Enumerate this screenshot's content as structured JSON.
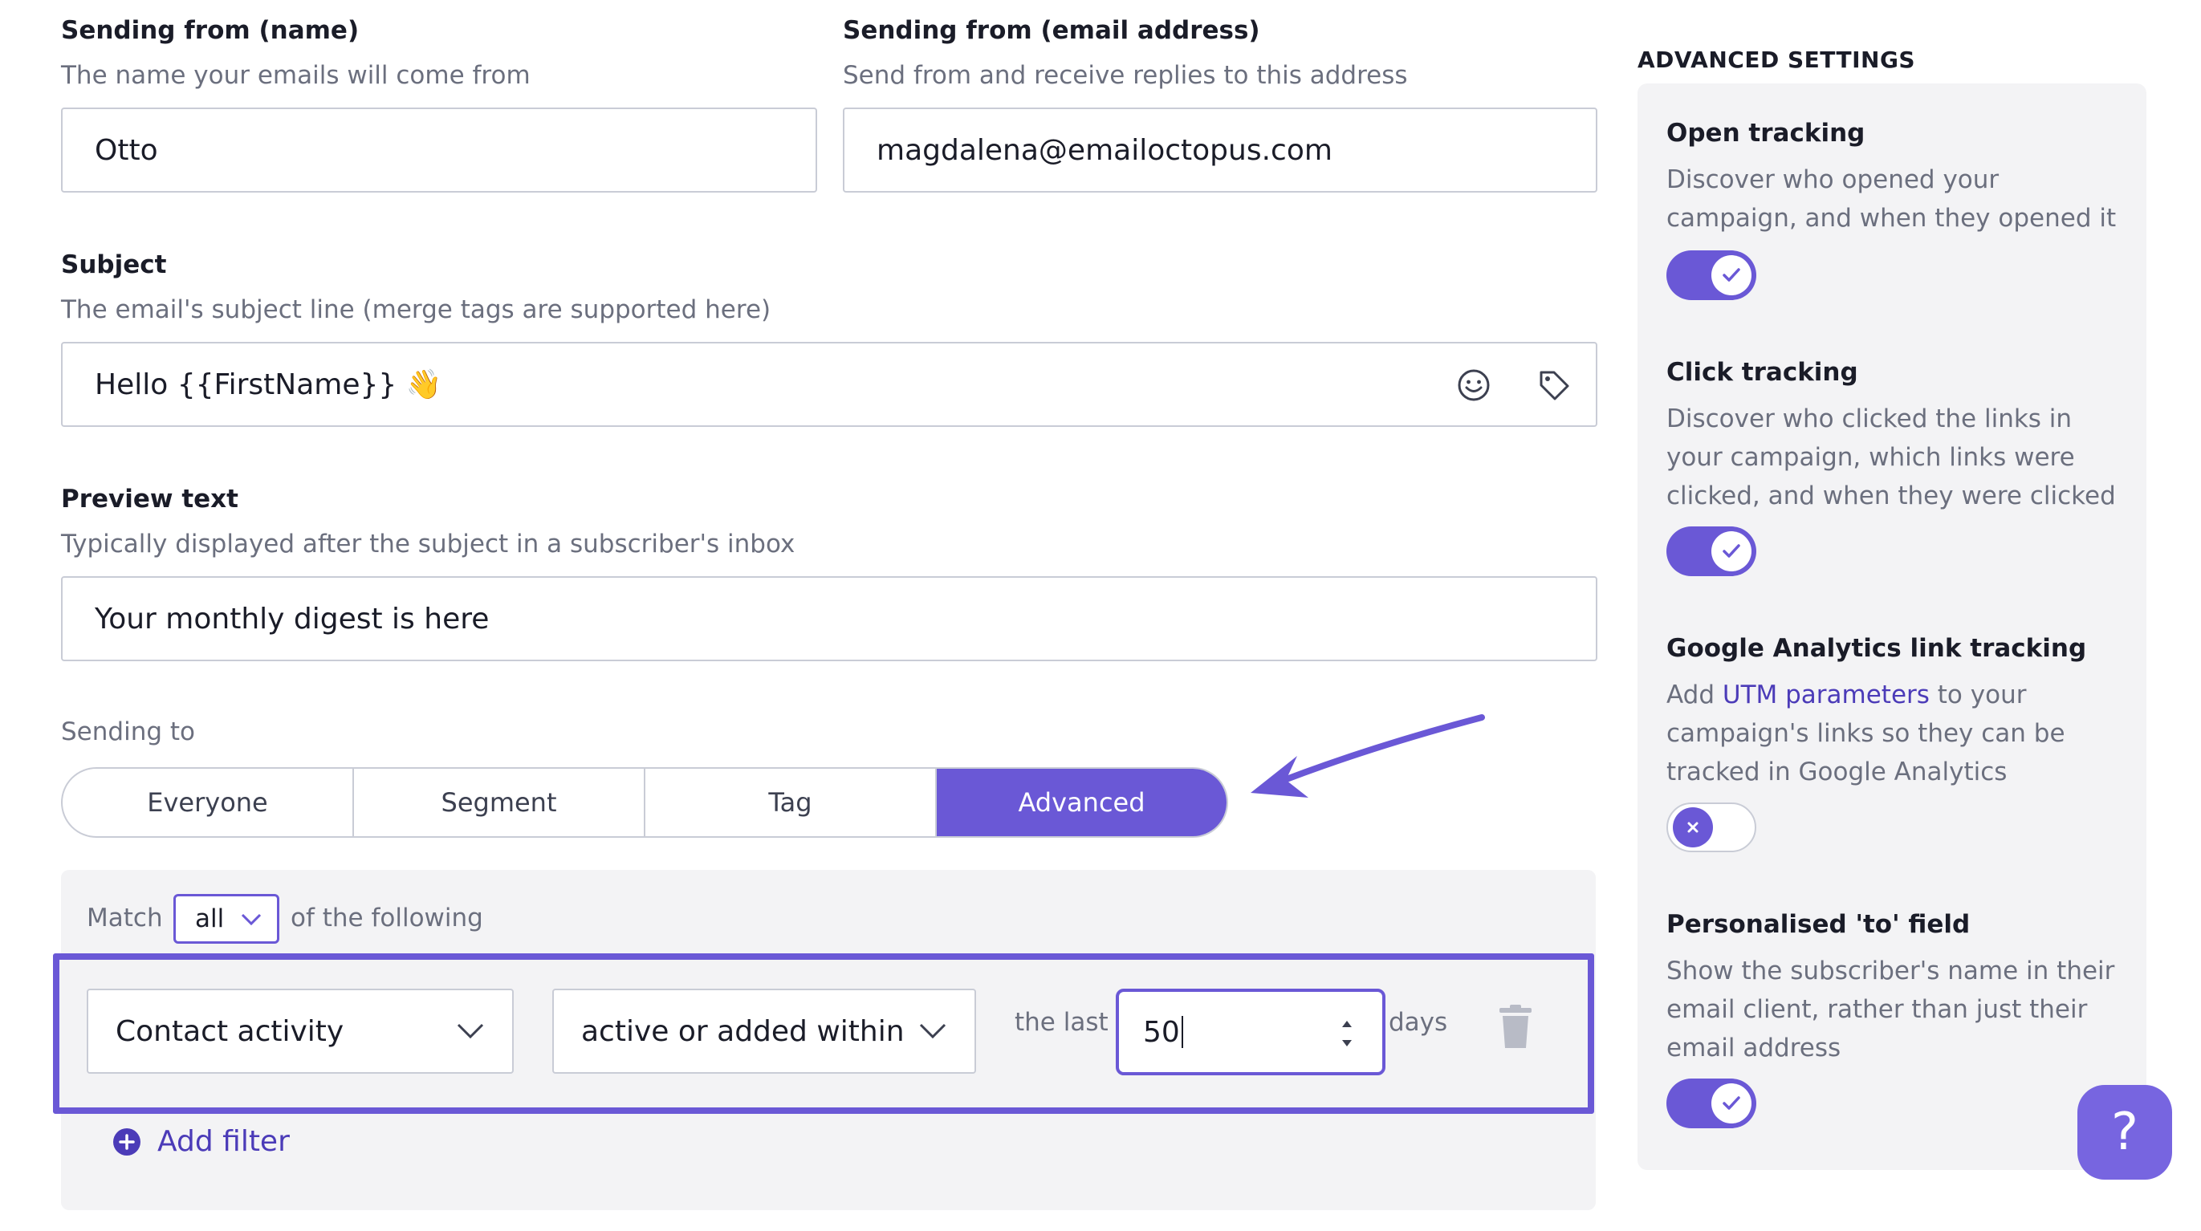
{
  "sender_name": {
    "label": "Sending from (name)",
    "help": "The name your emails will come from",
    "value": "Otto"
  },
  "sender_email": {
    "label": "Sending from (email address)",
    "help": "Send from and receive replies to this address",
    "value": "magdalena@emailoctopus.com"
  },
  "subject": {
    "label": "Subject",
    "help": "The email's subject line (merge tags are supported here)",
    "value": "Hello {{FirstName}} 👋",
    "icons": [
      "emoji-icon",
      "tag-icon"
    ]
  },
  "preview_text": {
    "label": "Preview text",
    "help": "Typically displayed after the subject in a subscriber's inbox",
    "value": "Your monthly digest is here"
  },
  "sending_to": {
    "label": "Sending to",
    "options": [
      "Everyone",
      "Segment",
      "Tag",
      "Advanced"
    ],
    "selected": "Advanced",
    "accent_color": "#6a58d6"
  },
  "advanced": {
    "match_prefix": "Match",
    "match_value": "all",
    "match_suffix": "of the following",
    "rule": {
      "field": "Contact activity",
      "condition": "active or added within",
      "the_last_label": "the last",
      "number": "50",
      "unit": "days"
    },
    "add_filter_label": "Add filter"
  },
  "advanced_settings": {
    "title": "ADVANCED SETTINGS",
    "open_tracking": {
      "title": "Open tracking",
      "description": "Discover who opened your campaign, and when they opened it",
      "enabled": true
    },
    "click_tracking": {
      "title": "Click tracking",
      "description": "Discover who clicked the links in your campaign, which links were clicked, and when they were clicked",
      "enabled": true
    },
    "ga_tracking": {
      "title": "Google Analytics link tracking",
      "desc_prefix": "Add ",
      "desc_link": "UTM parameters",
      "desc_suffix": " to your campaign's links so they can be tracked in Google Analytics",
      "enabled": false
    },
    "personalised_to": {
      "title": "Personalised 'to' field",
      "description": "Show the subscriber's name in their email client, rather than just their email address",
      "enabled": true
    }
  },
  "help_button": {
    "label": "?"
  }
}
